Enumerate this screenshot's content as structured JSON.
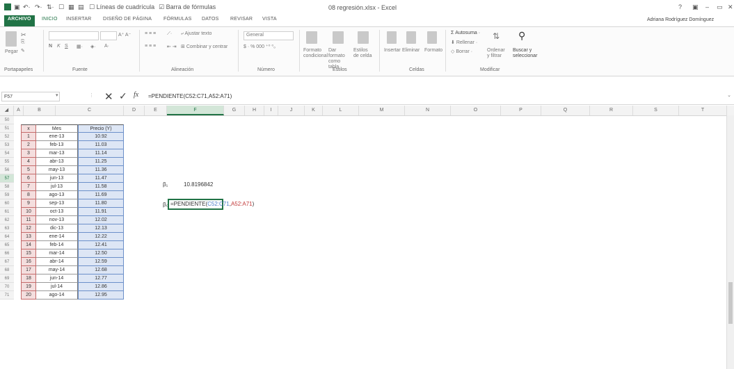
{
  "window": {
    "title": "08 regresión.xlsx - Excel",
    "user": "Adriana Rodríguez Domínguez",
    "qat": [
      "Líneas de cuadrícula",
      "Barra de fórmulas"
    ]
  },
  "tabs": [
    "ARCHIVO",
    "INICIO",
    "INSERTAR",
    "DISEÑO DE PÁGINA",
    "FÓRMULAS",
    "DATOS",
    "REVISAR",
    "VISTA"
  ],
  "ribbon": {
    "paste": "Pegar",
    "wrap_text": "Ajustar texto",
    "merge": "Combinar y centrar",
    "number_format": "General",
    "cond_format": "Formato condicional",
    "table_format": "Dar formato como tabla",
    "cell_styles": "Estilos de celda",
    "insert": "Insertar",
    "delete": "Eliminar",
    "format": "Formato",
    "autosum": "Autosuma",
    "fill": "Rellenar",
    "clear": "Borrar",
    "sort": "Ordenar y filtrar",
    "find": "Buscar y seleccionar",
    "groups": [
      "Portapapeles",
      "Fuente",
      "Alineación",
      "Número",
      "Estilos",
      "Celdas",
      "Modificar"
    ]
  },
  "formula_bar": {
    "name_box": "F57",
    "formula": "=PENDIENTE(C52:C71,A52:A71)"
  },
  "columns": [
    "A",
    "B",
    "C",
    "D",
    "E",
    "F",
    "G",
    "H",
    "I",
    "J",
    "K",
    "L",
    "M",
    "N",
    "O",
    "P",
    "Q",
    "R",
    "S",
    "T"
  ],
  "selected_column": "F",
  "rows": [
    "50",
    "51",
    "52",
    "53",
    "54",
    "55",
    "56",
    "57",
    "58",
    "59",
    "60",
    "61",
    "62",
    "63",
    "64",
    "65",
    "66",
    "67",
    "68",
    "69",
    "70",
    "71"
  ],
  "selected_row": "57",
  "table": {
    "headers": {
      "x": "x",
      "mes": "Mes",
      "precio": "Precio (Y)"
    },
    "x": [
      "1",
      "2",
      "3",
      "4",
      "5",
      "6",
      "7",
      "8",
      "9",
      "10",
      "11",
      "12",
      "13",
      "14",
      "15",
      "16",
      "17",
      "18",
      "19",
      "20"
    ],
    "mes": [
      "ene-13",
      "feb-13",
      "mar-13",
      "abr-13",
      "may-13",
      "jun-13",
      "jul-13",
      "ago-13",
      "sep-13",
      "oct-13",
      "nov-13",
      "dic-13",
      "ene-14",
      "feb-14",
      "mar-14",
      "abr-14",
      "may-14",
      "jun-14",
      "jul-14",
      "ago-14"
    ],
    "precio": [
      "10.92",
      "11.03",
      "11.14",
      "11.25",
      "11.36",
      "11.47",
      "11.58",
      "11.69",
      "11.80",
      "11.91",
      "12.02",
      "12.13",
      "12.22",
      "12.41",
      "12.50",
      "12.59",
      "12.68",
      "12.77",
      "12.86",
      "12.95"
    ]
  },
  "cells": {
    "b1_label": "β₁",
    "b1_value": "10.8196842",
    "b0_label": "β₀",
    "editing_text": "=PENDIENTE(",
    "editing_ref_c": "C52:C71",
    "editing_sep": ",",
    "editing_ref_a": "A52:A71",
    "editing_close": ")"
  }
}
